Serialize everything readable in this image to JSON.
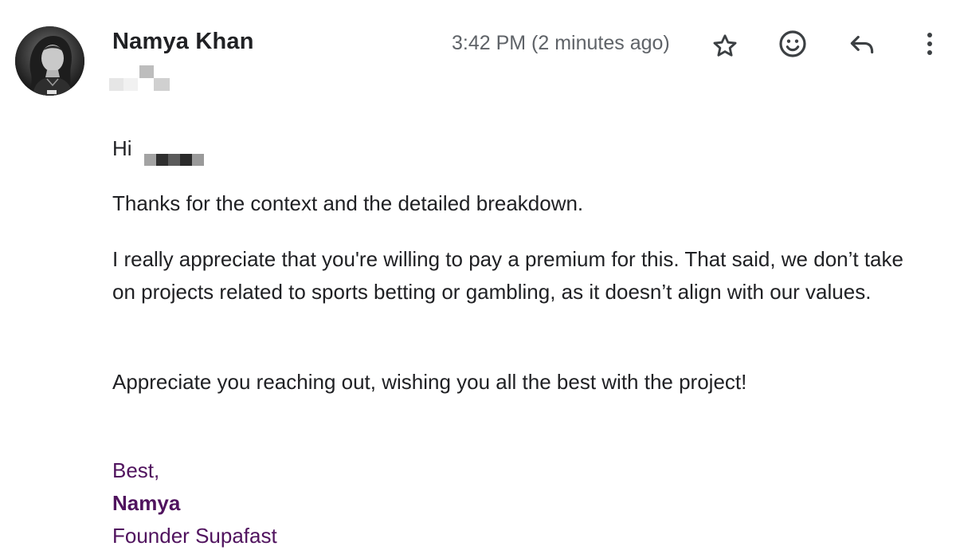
{
  "header": {
    "sender_name": "Namya Khan",
    "timestamp": "3:42 PM (2 minutes ago)",
    "actions": {
      "star": "star-icon",
      "react": "emoji-icon",
      "reply": "reply-icon",
      "more": "more-vert-icon"
    }
  },
  "body": {
    "greeting": "Hi",
    "paragraphs": [
      "Thanks for the context and the detailed breakdown.",
      "I really appreciate that you're willing to pay a premium for this. That said, we don’t take on projects related to sports betting or gambling, as it doesn’t align with our values.",
      "Appreciate you reaching out, wishing you all the best with the project!"
    ]
  },
  "signature": {
    "closing": "Best,",
    "name": "Namya",
    "title": "Founder Supafast"
  },
  "colors": {
    "text": "#202124",
    "meta": "#5f6368",
    "signature": "#50135e"
  }
}
